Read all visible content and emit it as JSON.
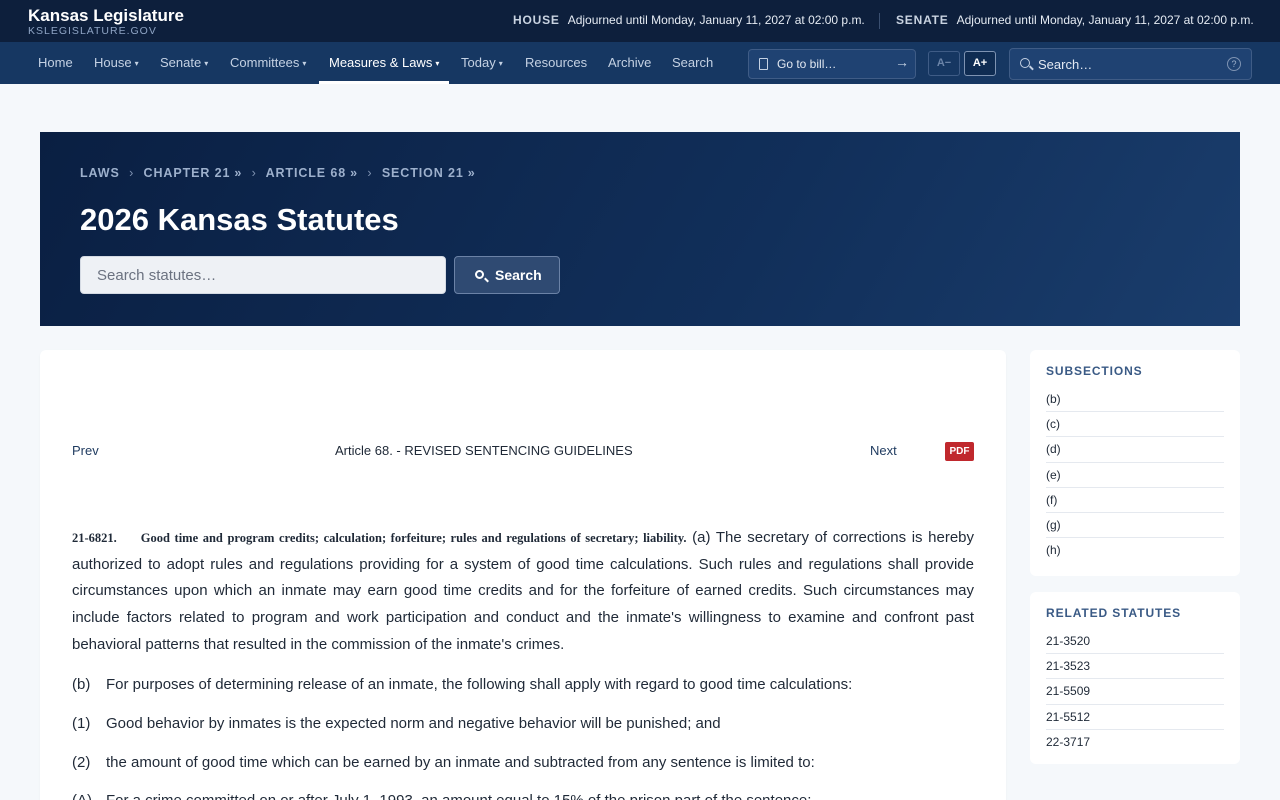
{
  "brand": {
    "title": "Kansas Legislature",
    "subtitle": "KSLEGISLATURE.GOV"
  },
  "status": {
    "house_label": "HOUSE",
    "house_text": "Adjourned until Monday, January 11, 2027 at 02:00 p.m.",
    "senate_label": "SENATE",
    "senate_text": "Adjourned until Monday, January 11, 2027 at 02:00 p.m."
  },
  "nav": {
    "items": [
      {
        "label": "Home",
        "dropdown": false,
        "active": false
      },
      {
        "label": "House",
        "dropdown": true,
        "active": false
      },
      {
        "label": "Senate",
        "dropdown": true,
        "active": false
      },
      {
        "label": "Committees",
        "dropdown": true,
        "active": false
      },
      {
        "label": "Measures & Laws",
        "dropdown": true,
        "active": true
      },
      {
        "label": "Today",
        "dropdown": true,
        "active": false
      },
      {
        "label": "Resources",
        "dropdown": false,
        "active": false
      },
      {
        "label": "Archive",
        "dropdown": false,
        "active": false
      },
      {
        "label": "Search",
        "dropdown": false,
        "active": false
      }
    ],
    "caret": "▾",
    "goto_bill": "Go to bill…",
    "goto_arrow": "→",
    "font_smaller": "A−",
    "font_larger": "A+",
    "search_placeholder": "Search…",
    "help_glyph": "?"
  },
  "hero": {
    "breadcrumb": [
      {
        "label": "LAWS",
        "suffix": ""
      },
      {
        "label": "CHAPTER 21",
        "suffix": "»"
      },
      {
        "label": "ARTICLE 68",
        "suffix": "»"
      },
      {
        "label": "SECTION 21",
        "suffix": "»"
      }
    ],
    "breadcrumb_sep": "›",
    "title": "2026 Kansas Statutes",
    "search_placeholder": "Search statutes…",
    "search_button": "Search"
  },
  "statute_nav": {
    "prev": "Prev",
    "article": "Article 68. - REVISED SENTENCING GUIDELINES",
    "next": "Next",
    "pdf": "PDF"
  },
  "statute": {
    "number": "21-6821.",
    "caption": "Good time and program credits; calculation; forfeiture; rules and regulations of secretary; liability.",
    "intro": "(a) The secretary of corrections is hereby authorized to adopt rules and regulations providing for a system of good time calculations. Such rules and regulations shall provide circumstances upon which an inmate may earn good time credits and for the forfeiture of earned credits. Such circumstances may include factors related to program and work participation and conduct and the inmate's willingness to examine and confront past behavioral patterns that resulted in the commission of the inmate's crimes.",
    "paragraphs": [
      {
        "tag": "(b)",
        "text": "For purposes of determining release of an inmate, the following shall apply with regard to good time calculations:"
      },
      {
        "tag": "(1)",
        "text": "Good behavior by inmates is the expected norm and negative behavior will be punished; and"
      },
      {
        "tag": "(2)",
        "text": "the amount of good time which can be earned by an inmate and subtracted from any sentence is limited to:"
      },
      {
        "tag": "(A)",
        "text": "For a crime committed on or after July 1, 1993, an amount equal to 15% of the prison part of the sentence;"
      }
    ]
  },
  "sidebar": {
    "subsections_title": "SUBSECTIONS",
    "subsections": [
      "(b)",
      "(c)",
      "(d)",
      "(e)",
      "(f)",
      "(g)",
      "(h)"
    ],
    "related_title": "RELATED STATUTES",
    "related": [
      "21-3520",
      "21-3523",
      "21-5509",
      "21-5512",
      "22-3717"
    ]
  }
}
